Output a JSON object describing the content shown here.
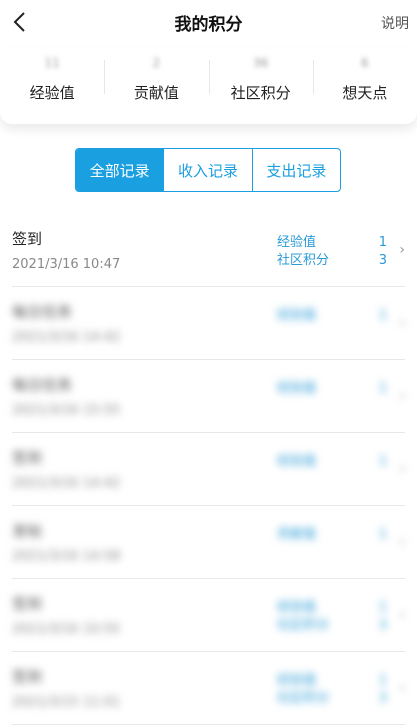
{
  "header": {
    "title": "我的积分",
    "help_label": "说明"
  },
  "stats": [
    {
      "value": "11",
      "label": "经验值"
    },
    {
      "value": "2",
      "label": "贡献值"
    },
    {
      "value": "36",
      "label": "社区积分"
    },
    {
      "value": "6",
      "label": "想天点"
    }
  ],
  "tabs": [
    {
      "label": "全部记录",
      "active": true
    },
    {
      "label": "收入记录",
      "active": false
    },
    {
      "label": "支出记录",
      "active": false
    }
  ],
  "records": [
    {
      "title": "签到",
      "time": "2021/3/16 10:47",
      "entries": [
        {
          "name": "经验值",
          "amount": "1"
        },
        {
          "name": "社区积分",
          "amount": "3"
        }
      ]
    },
    {
      "title": "每日任务",
      "time": "2021/3/16 14:42",
      "entries": [
        {
          "name": "经验值",
          "amount": "1"
        }
      ]
    },
    {
      "title": "每日任务",
      "time": "2021/3/16 15:55",
      "entries": [
        {
          "name": "经验值",
          "amount": "1"
        }
      ]
    },
    {
      "title": "签到",
      "time": "2021/3/16 14:42",
      "entries": [
        {
          "name": "经验值",
          "amount": "1"
        }
      ]
    },
    {
      "title": "发帖",
      "time": "2021/3/16 14:58",
      "entries": [
        {
          "name": "贡献值",
          "amount": "1"
        }
      ]
    },
    {
      "title": "签到",
      "time": "2021/3/16 10:55",
      "entries": [
        {
          "name": "经验值",
          "amount": "1"
        },
        {
          "name": "社区积分",
          "amount": "3"
        }
      ]
    },
    {
      "title": "签到",
      "time": "2021/3/15 11:01",
      "entries": [
        {
          "name": "经验值",
          "amount": "1"
        },
        {
          "name": "社区积分",
          "amount": "3"
        }
      ]
    }
  ]
}
